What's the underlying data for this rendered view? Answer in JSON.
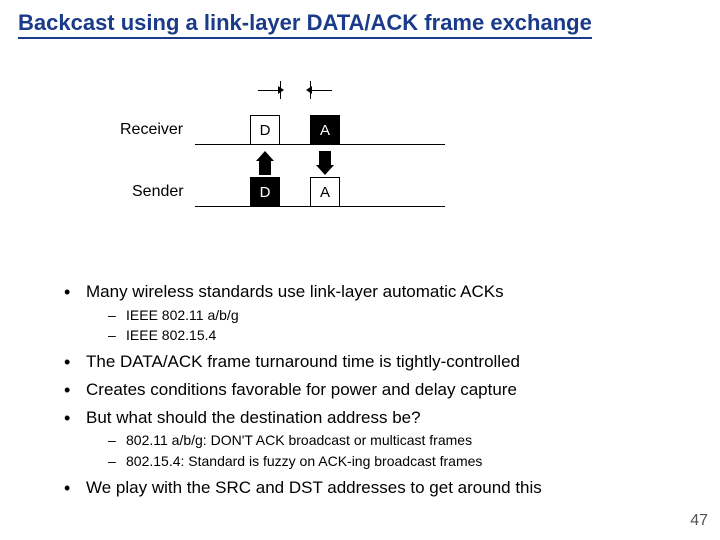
{
  "title": "Backcast using a link-layer DATA/ACK frame exchange",
  "diagram": {
    "receiver_label": "Receiver",
    "sender_label": "Sender",
    "d": "D",
    "a": "A"
  },
  "bullets": [
    {
      "text": "Many wireless standards use link-layer automatic ACKs",
      "sub": [
        "IEEE 802.11 a/b/g",
        "IEEE 802.15.4"
      ]
    },
    {
      "text": "The DATA/ACK frame turnaround time is tightly-controlled"
    },
    {
      "text": "Creates conditions favorable for power and delay capture"
    },
    {
      "text": "But what should the destination address be?",
      "sub": [
        "802.11 a/b/g: DON'T ACK broadcast or multicast frames",
        "802.15.4: Standard is fuzzy on ACK-ing broadcast frames"
      ]
    },
    {
      "text": "We play with the SRC and DST addresses to get around this"
    }
  ],
  "page": "47"
}
